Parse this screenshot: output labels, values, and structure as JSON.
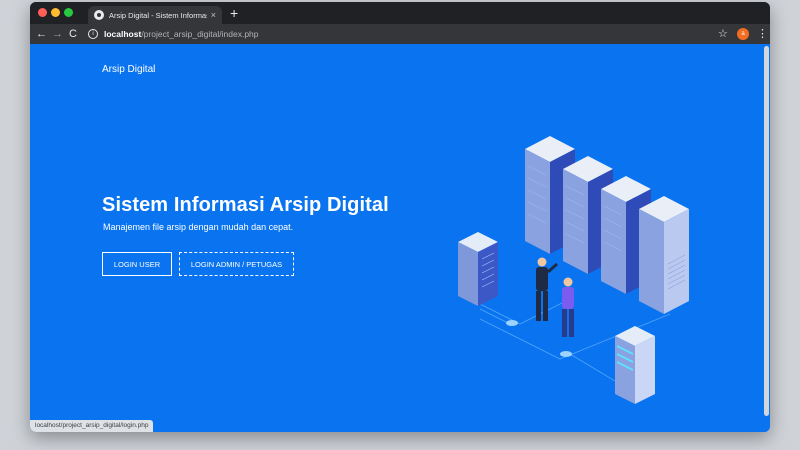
{
  "browser": {
    "tab_title": "Arsip Digital - Sistem Informasi A",
    "tab_close": "×",
    "new_tab": "+",
    "nav_back": "←",
    "nav_forward": "→",
    "nav_reload": "C",
    "url_host": "localhost",
    "url_path": "/project_arsip_digital/index.php",
    "star": "☆",
    "avatar_initial": "a",
    "menu": "⋮",
    "info": "i"
  },
  "page": {
    "brand": "Arsip Digital",
    "title": "Sistem Informasi Arsip Digital",
    "subtitle": "Manajemen file arsip dengan mudah dan cepat.",
    "login_user": "LOGIN USER",
    "login_admin": "LOGIN ADMIN / PETUGAS",
    "background_color": "#0a74f0"
  },
  "status_bar": {
    "url": "localhost/project_arsip_digital/login.php"
  }
}
